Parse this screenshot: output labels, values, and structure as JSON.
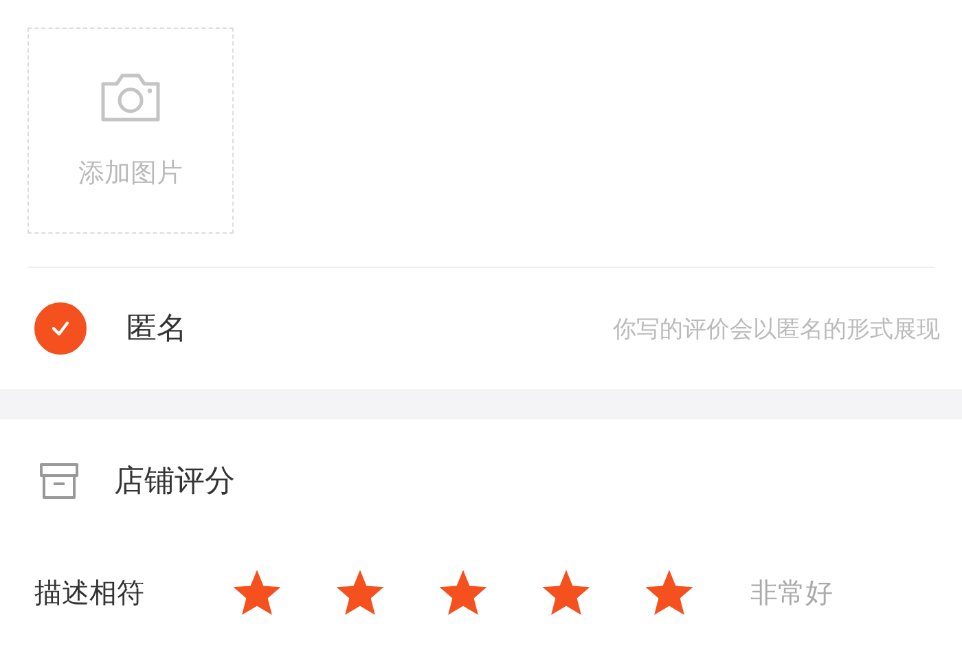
{
  "add_image": {
    "label": "添加图片"
  },
  "anonymous": {
    "label": "匿名",
    "checked": true,
    "hint": "你写的评价会以匿名的形式展现"
  },
  "store_rating": {
    "title": "店铺评分",
    "ratings": [
      {
        "label": "描述相符",
        "stars": 5,
        "verdict": "非常好"
      }
    ]
  }
}
